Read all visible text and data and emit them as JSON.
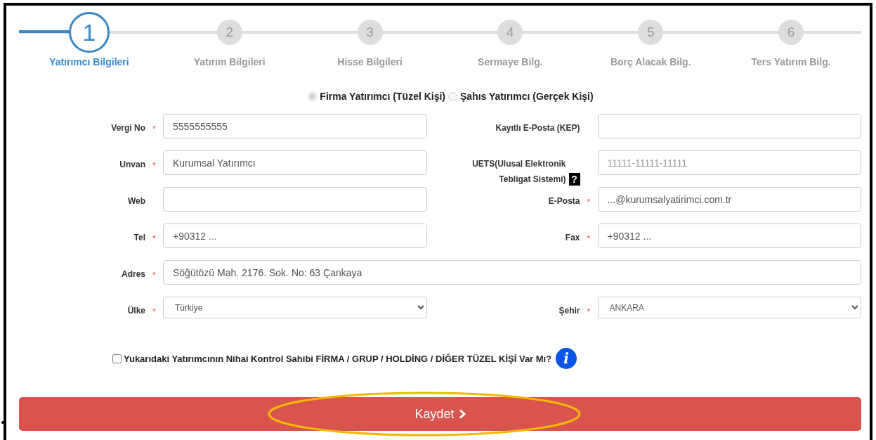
{
  "steps": [
    {
      "number": "1",
      "label": "Yatırımcı Bilgileri",
      "selected": true
    },
    {
      "number": "2",
      "label": "Yatırım Bilgileri",
      "selected": false
    },
    {
      "number": "3",
      "label": "Hisse Bilgileri",
      "selected": false
    },
    {
      "number": "4",
      "label": "Sermaye Bilg.",
      "selected": false
    },
    {
      "number": "5",
      "label": "Borç Alacak Bilg.",
      "selected": false
    },
    {
      "number": "6",
      "label": "Ters Yatırım Bilg.",
      "selected": false
    }
  ],
  "investor_type": [
    {
      "label": "Firma Yatırımcı (Tüzel Kişi)",
      "selected": true
    },
    {
      "label": "Şahıs Yatırımcı (Gerçek Kişi)",
      "selected": false
    }
  ],
  "form_rows": [
    [
      {
        "kind": "input",
        "label": "Vergi No",
        "required": true,
        "value": "5555555555"
      },
      {
        "kind": "input",
        "label": "Kayıtlı E-Posta (KEP)",
        "required": false
      }
    ],
    [
      {
        "kind": "input",
        "label": "Unvan",
        "required": true,
        "value": "Kurumsal Yatırımcı"
      },
      {
        "kind": "input",
        "label": "UETS(Ulusal Elektronik Tebligat Sistemi)",
        "required": false,
        "help": true,
        "help_icon": "?",
        "placeholder": "11111-11111-11111"
      }
    ],
    [
      {
        "kind": "input",
        "label": "Web",
        "required": false
      },
      {
        "kind": "input",
        "label": "E-Posta",
        "required": true,
        "value": "...@kurumsalyatirimci.com.tr"
      }
    ],
    [
      {
        "kind": "input",
        "label": "Tel",
        "required": true,
        "value": "+90312 ..."
      },
      {
        "kind": "input",
        "label": "Fax",
        "required": true,
        "value": "+90312 ..."
      }
    ],
    [
      {
        "kind": "input",
        "label": "Adres",
        "required": true,
        "value": "Söğütözü Mah. 2176. Sok. No: 63 Çankaya"
      }
    ],
    [
      {
        "kind": "select",
        "label": "Ülke",
        "required": true,
        "value": "Türkiye"
      },
      {
        "kind": "select",
        "label": "Şehir",
        "required": true,
        "value": "ANKARA"
      }
    ]
  ],
  "required_mark": "*",
  "ultimate_owner": {
    "label": "Yukarıdaki Yatırımcının Nihai Kontrol Sahibi FİRMA / GRUP / HOLDİNG / DİĞER TÜZEL KİŞİ Var Mı?",
    "checked": false,
    "info_icon": "i"
  },
  "save_button": {
    "label": "Kaydet",
    "highlighted": true
  }
}
